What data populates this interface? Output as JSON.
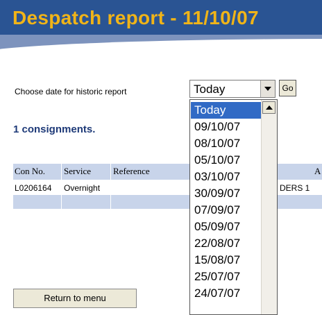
{
  "header": {
    "title": "Despatch report -  11/10/07"
  },
  "date_chooser": {
    "label": "Choose date for historic report",
    "selected": "Today",
    "go_label": "Go",
    "options": [
      "Today",
      "09/10/07",
      "08/10/07",
      "05/10/07",
      "03/10/07",
      "30/09/07",
      "07/09/07",
      "05/09/07",
      "22/08/07",
      "15/08/07",
      "25/07/07",
      "24/07/07"
    ]
  },
  "summary": {
    "text": "1 consignments."
  },
  "table": {
    "headers": [
      "Con No.",
      "Service",
      "Reference",
      "A"
    ],
    "rows": [
      [
        "L0206164",
        "Overnight",
        "",
        "DERS 1"
      ]
    ]
  },
  "return_label": "Return to menu",
  "colors": {
    "header_bg": "#2a5493",
    "title": "#f0b418",
    "table_band": "#c8d4ea",
    "selected": "#316ac5"
  }
}
